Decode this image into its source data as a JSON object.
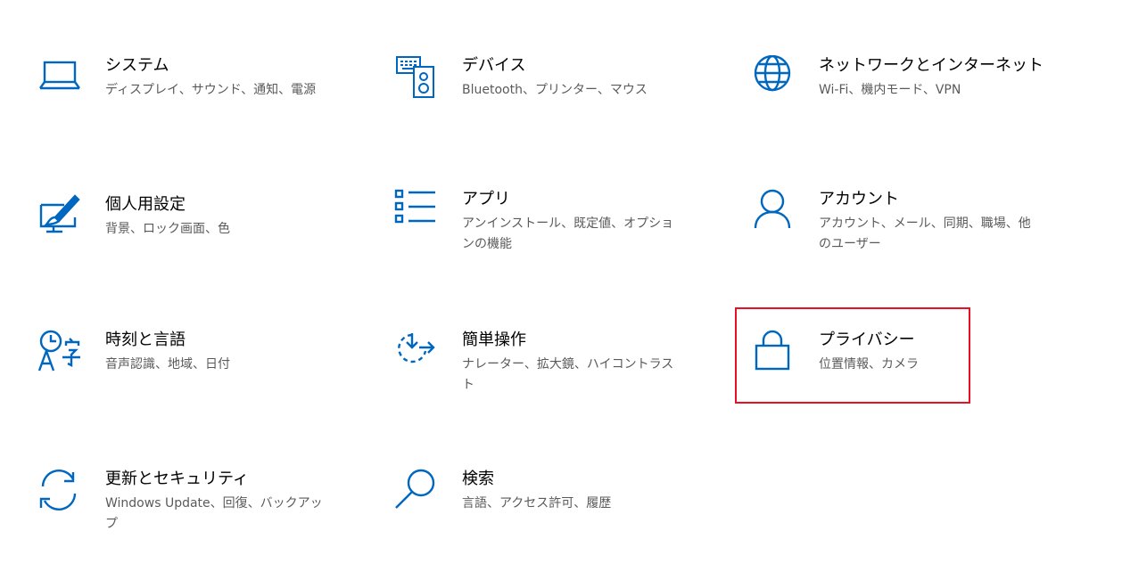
{
  "accent": "#0067c0",
  "highlight_color": "#e81123",
  "tiles": [
    {
      "title": "システム",
      "desc": "ディスプレイ、サウンド、通知、電源",
      "icon": "laptop-icon"
    },
    {
      "title": "デバイス",
      "desc": "Bluetooth、プリンター、マウス",
      "icon": "devices-icon"
    },
    {
      "title": "ネットワークとインターネット",
      "desc": "Wi-Fi、機内モード、VPN",
      "icon": "globe-icon"
    },
    {
      "title": "個人用設定",
      "desc": "背景、ロック画面、色",
      "icon": "personalization-icon"
    },
    {
      "title": "アプリ",
      "desc": "アンインストール、既定値、オプションの機能",
      "icon": "apps-list-icon"
    },
    {
      "title": "アカウント",
      "desc": "アカウント、メール、同期、職場、他のユーザー",
      "icon": "person-icon"
    },
    {
      "title": "時刻と言語",
      "desc": "音声認識、地域、日付",
      "icon": "time-language-icon"
    },
    {
      "title": "簡単操作",
      "desc": "ナレーター、拡大鏡、ハイコントラスト",
      "icon": "ease-of-access-icon"
    },
    {
      "title": "プライバシー",
      "desc": "位置情報、カメラ",
      "icon": "lock-icon"
    },
    {
      "title": "更新とセキュリティ",
      "desc": "Windows Update、回復、バックアップ",
      "icon": "sync-arrows-icon"
    },
    {
      "title": "検索",
      "desc": "言語、アクセス許可、履歴",
      "icon": "search-icon"
    }
  ]
}
